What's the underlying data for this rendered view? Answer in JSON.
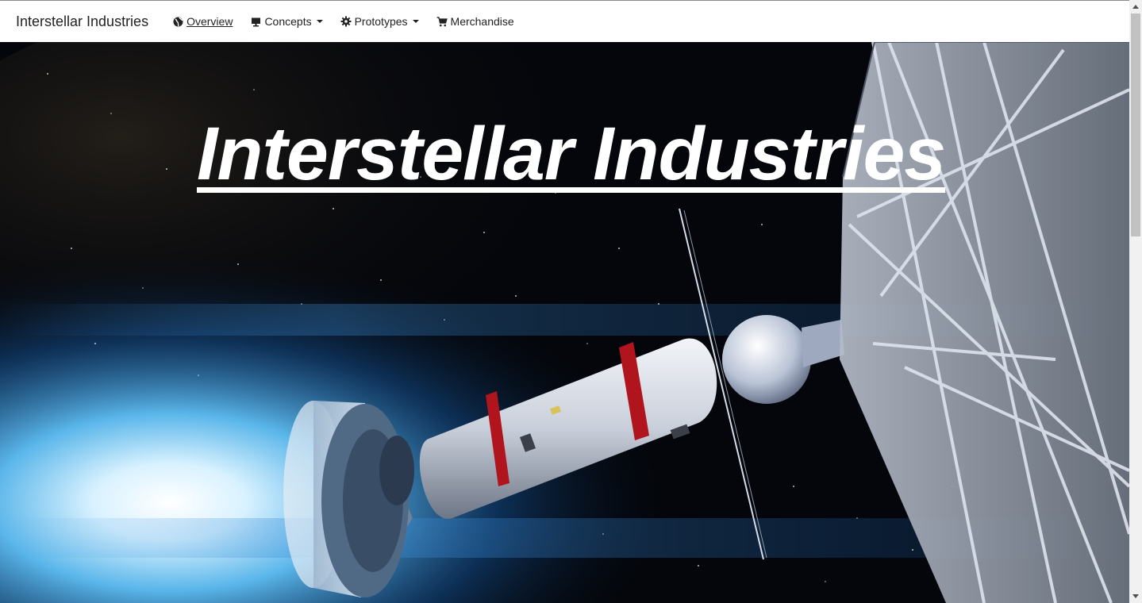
{
  "navbar": {
    "brand": "Interstellar Industries",
    "items": [
      {
        "label": "Overview",
        "icon": "globe-icon",
        "active": true,
        "dropdown": false
      },
      {
        "label": "Concepts",
        "icon": "monitor-icon",
        "active": false,
        "dropdown": true
      },
      {
        "label": "Prototypes",
        "icon": "gear-icon",
        "active": false,
        "dropdown": true
      },
      {
        "label": "Merchandise",
        "icon": "cart-icon",
        "active": false,
        "dropdown": false
      }
    ]
  },
  "hero": {
    "title": "Interstellar Industries",
    "image": "spacecraft-illustration"
  },
  "colors": {
    "nav_background": "#ffffff",
    "nav_text": "#222222",
    "hero_background": "#04060b",
    "hero_title": "#ffffff",
    "stripe_red": "#b0141c"
  }
}
